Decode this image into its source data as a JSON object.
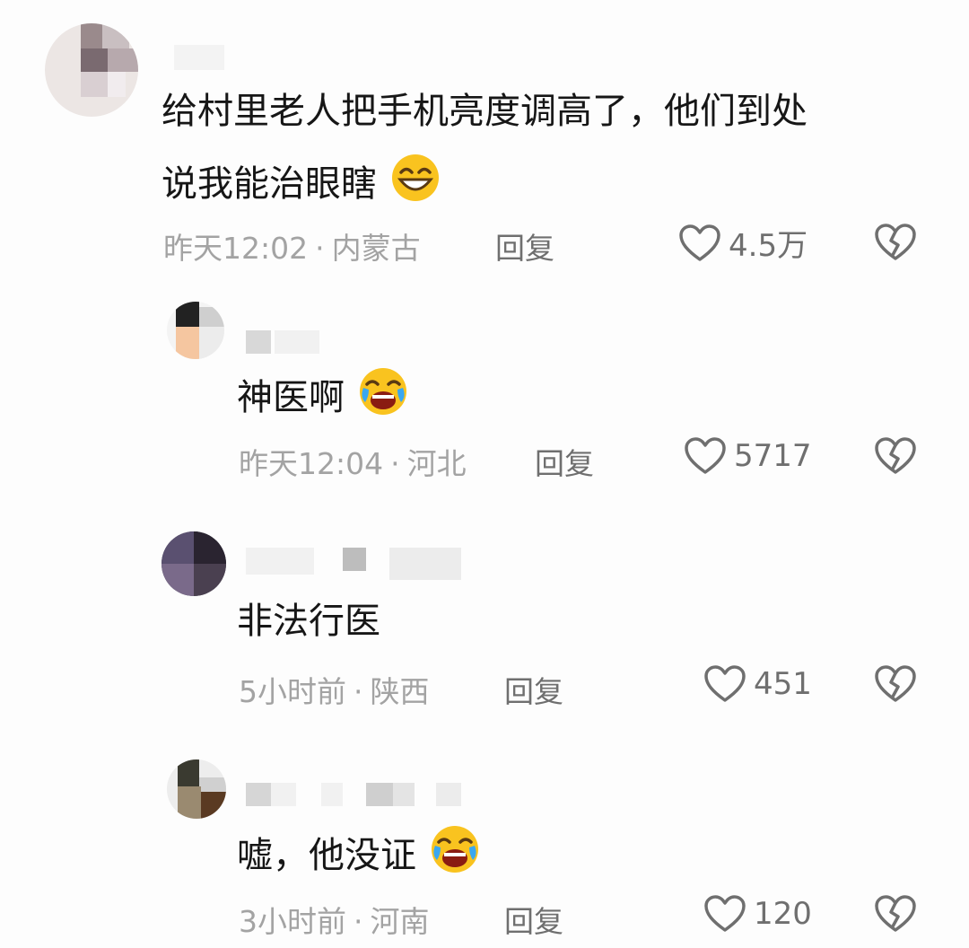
{
  "comments": [
    {
      "text": "给村里老人把手机亮度调高了，他们到处",
      "text2": "说我能治眼瞎",
      "emoji": "grinning-face-emoji",
      "time": "昨天12:02",
      "sep": "·",
      "location": "内蒙古",
      "reply_label": "回复",
      "likes": "4.5万"
    },
    {
      "text": "神医啊",
      "emoji": "rolling-laughing-emoji",
      "time": "昨天12:04",
      "sep": "·",
      "location": "河北",
      "reply_label": "回复",
      "likes": "5717"
    },
    {
      "text": "非法行医",
      "time": "5小时前",
      "sep": "·",
      "location": "陕西",
      "reply_label": "回复",
      "likes": "451"
    },
    {
      "text": "嘘，他没证",
      "emoji": "rolling-laughing-emoji",
      "time": "3小时前",
      "sep": "·",
      "location": "河南",
      "reply_label": "回复",
      "likes": "120"
    }
  ],
  "icons": {
    "like": "heart-outline-icon",
    "dislike": "broken-heart-icon"
  },
  "colors": {
    "meta_gray": "#a3a3a3",
    "action_gray": "#6f6f6f",
    "text": "#161616",
    "emoji_yellow": "#f9c31f"
  }
}
